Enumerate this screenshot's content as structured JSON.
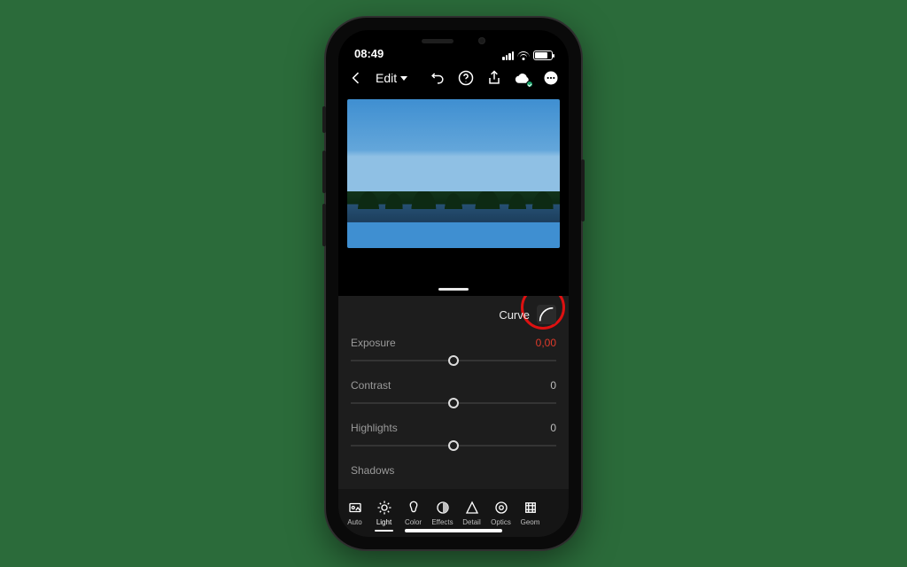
{
  "statusbar": {
    "time": "08:49"
  },
  "appbar": {
    "edit_label": "Edit"
  },
  "panel": {
    "curve_label": "Curve",
    "sliders": {
      "exposure": {
        "label": "Exposure",
        "value": "0,00"
      },
      "contrast": {
        "label": "Contrast",
        "value": "0"
      },
      "highlights": {
        "label": "Highlights",
        "value": "0"
      },
      "shadows": {
        "label": "Shadows",
        "value": ""
      }
    }
  },
  "toolbar": {
    "items": [
      {
        "label": "Auto"
      },
      {
        "label": "Light"
      },
      {
        "label": "Color"
      },
      {
        "label": "Effects"
      },
      {
        "label": "Detail"
      },
      {
        "label": "Optics"
      },
      {
        "label": "Geom"
      }
    ]
  }
}
